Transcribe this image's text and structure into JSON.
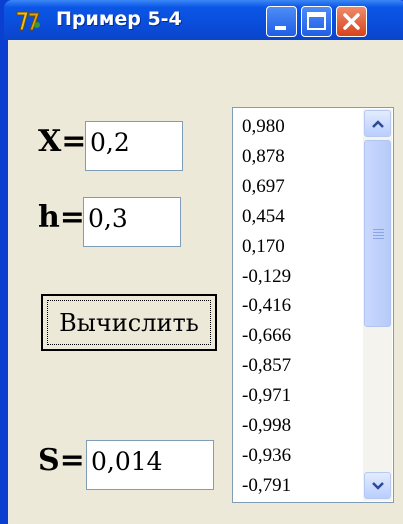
{
  "window": {
    "title": "Пример 5-4"
  },
  "labels": {
    "x": "X=",
    "h": "h=",
    "s": "S="
  },
  "fields": {
    "x_value": "0,2",
    "h_value": "0,3",
    "s_value": "0,014"
  },
  "buttons": {
    "calculate": "Вычислить"
  },
  "list": {
    "items": [
      "0,980",
      "0,878",
      "0,697",
      "0,454",
      "0,170",
      "-0,129",
      "-0,416",
      "-0,666",
      "-0,857",
      "-0,971",
      "-0,998",
      "-0,936",
      "-0,791"
    ]
  },
  "colors": {
    "titlebar": "#0a4ddb",
    "client": "#ece9d8",
    "close_button": "#d6431e"
  }
}
